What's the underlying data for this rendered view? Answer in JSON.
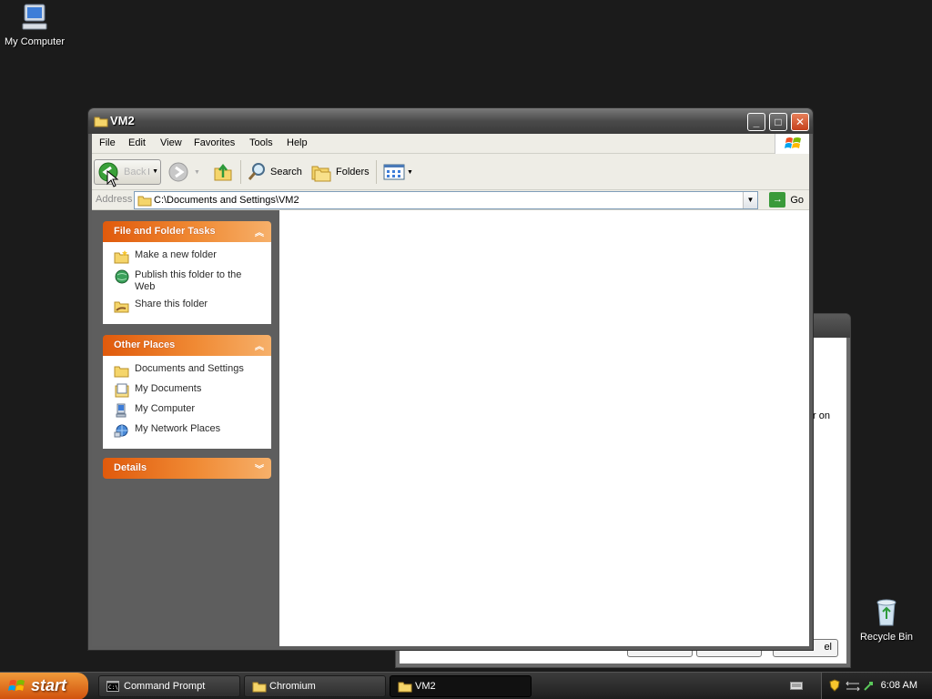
{
  "desktop": {
    "icons": [
      {
        "label": "My Computer",
        "icon": "my-computer-icon"
      },
      {
        "label": "Recycle Bin",
        "icon": "recycle-bin-icon"
      }
    ]
  },
  "background_window": {
    "partial_text": "r on",
    "button_label": "el"
  },
  "window": {
    "title": "VM2",
    "menu": [
      "File",
      "Edit",
      "View",
      "Favorites",
      "Tools",
      "Help"
    ],
    "toolbar": {
      "back": "Back",
      "search": "Search",
      "folders": "Folders"
    },
    "address": {
      "label": "Address",
      "value": "C:\\Documents and Settings\\VM2",
      "go": "Go"
    },
    "task_pane": {
      "groups": [
        {
          "title": "File and Folder Tasks",
          "chevron": "up",
          "items": [
            {
              "label": "Make a new folder",
              "icon": "new-folder-icon"
            },
            {
              "label": "Publish this folder to the Web",
              "icon": "publish-web-icon"
            },
            {
              "label": "Share this folder",
              "icon": "share-folder-icon"
            }
          ]
        },
        {
          "title": "Other Places",
          "chevron": "up",
          "items": [
            {
              "label": "Documents and Settings",
              "icon": "folder-icon"
            },
            {
              "label": "My Documents",
              "icon": "my-documents-icon"
            },
            {
              "label": "My Computer",
              "icon": "my-computer-icon"
            },
            {
              "label": "My Network Places",
              "icon": "network-places-icon"
            }
          ]
        },
        {
          "title": "Details",
          "chevron": "down",
          "items": []
        }
      ]
    }
  },
  "taskbar": {
    "start": "start",
    "tasks": [
      {
        "label": "Command Prompt",
        "icon": "command-prompt-icon",
        "active": false
      },
      {
        "label": "Chromium",
        "icon": "folder-icon",
        "active": false
      },
      {
        "label": "VM2",
        "icon": "folder-icon",
        "active": true
      }
    ],
    "clock": "6:08 AM"
  },
  "colors": {
    "task_header": "#e05a0c",
    "desktop": "#1b1b1b",
    "taskbar": "#2a2a2a"
  }
}
